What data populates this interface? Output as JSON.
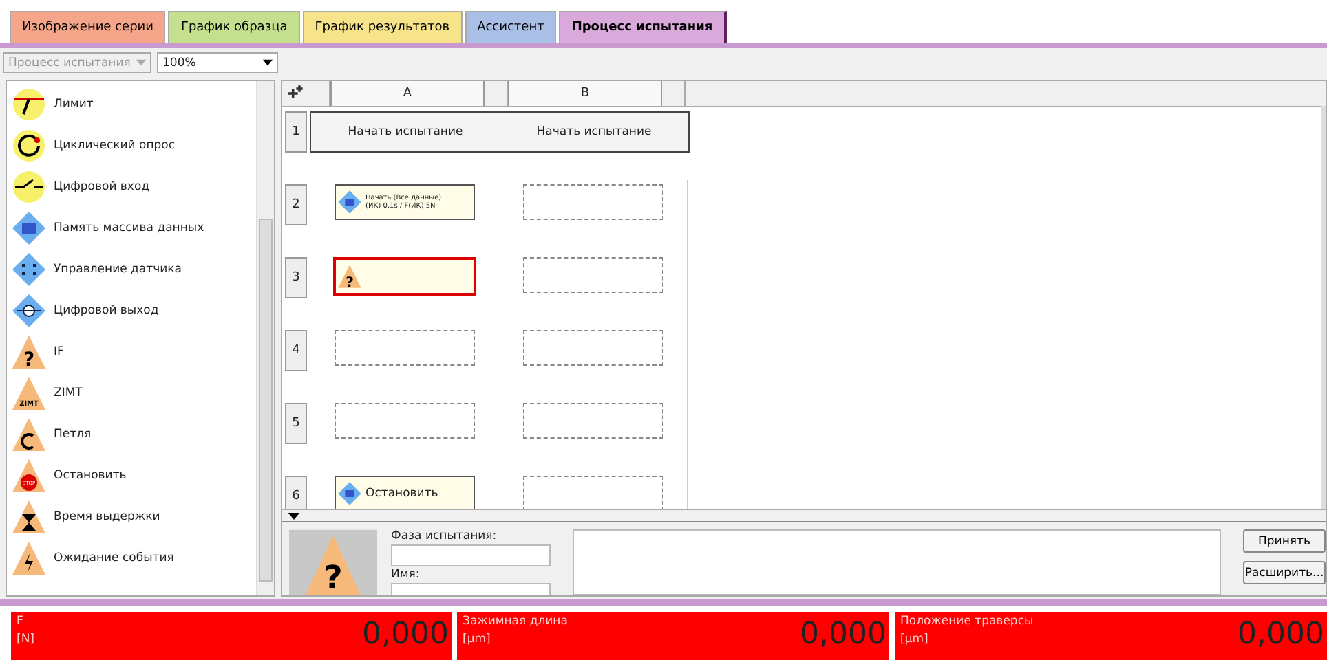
{
  "tabs": [
    {
      "label": "Изображение серии",
      "color": "#f4a58a",
      "selected": false
    },
    {
      "label": "График образца",
      "color": "#c4e08f",
      "selected": false
    },
    {
      "label": "График результатов",
      "color": "#f7e48a",
      "selected": false
    },
    {
      "label": "Ассистент",
      "color": "#a9bfe6",
      "selected": false
    },
    {
      "label": "Процесс испытания",
      "color": "#d9a9dc",
      "selected": true
    }
  ],
  "toolbar": {
    "process_select": {
      "value": "Процесс испытания",
      "disabled": true
    },
    "zoom_select": {
      "value": "100%",
      "disabled": false
    }
  },
  "palette": [
    {
      "label": "Лимит",
      "kind": "limit"
    },
    {
      "label": "Циклический опрос",
      "kind": "cycle"
    },
    {
      "label": "Цифровой вход",
      "kind": "digital_in"
    },
    {
      "label": "Память массива данных",
      "kind": "memory"
    },
    {
      "label": "Управление датчика",
      "kind": "sensor"
    },
    {
      "label": "Цифровой выход",
      "kind": "digital_out"
    },
    {
      "label": "IF",
      "kind": "if",
      "icon_text": "?"
    },
    {
      "label": "ZIMT",
      "kind": "zimt",
      "icon_text": "ZIMT"
    },
    {
      "label": "Петля",
      "kind": "loop"
    },
    {
      "label": "Остановить",
      "kind": "stop",
      "icon_text": "STOP"
    },
    {
      "label": "Время выдержки",
      "kind": "hold"
    },
    {
      "label": "Ожидание события",
      "kind": "wait"
    }
  ],
  "grid": {
    "columns": [
      "A",
      "B"
    ],
    "rows": [
      {
        "number": "1",
        "cells": [
          {
            "kind": "start",
            "label": "Начать испытание"
          },
          {
            "kind": "start",
            "label": "Начать испытание"
          }
        ]
      },
      {
        "number": "2",
        "cells": [
          {
            "kind": "memory",
            "lines": [
              "Начать (Все данные)",
              "(ИК) 0.1s / F(ИК) 5N"
            ],
            "selected": false
          },
          {
            "kind": "empty"
          }
        ]
      },
      {
        "number": "3",
        "cells": [
          {
            "kind": "if",
            "icon_text": "?",
            "selected": true
          },
          {
            "kind": "empty"
          }
        ]
      },
      {
        "number": "4",
        "cells": [
          {
            "kind": "empty"
          },
          {
            "kind": "empty"
          }
        ]
      },
      {
        "number": "5",
        "cells": [
          {
            "kind": "empty"
          },
          {
            "kind": "empty"
          }
        ]
      },
      {
        "number": "6",
        "cells": [
          {
            "kind": "memory",
            "lines": [
              "Остановить"
            ],
            "selected": false
          },
          {
            "kind": "empty"
          }
        ]
      }
    ]
  },
  "details": {
    "icon_text": "?",
    "phase_label": "Фаза испытания:",
    "name_label": "Имя:",
    "buttons": [
      "Принять",
      "Расширить..."
    ]
  },
  "status": [
    {
      "name": "F",
      "unit": "[N]",
      "value": "0,000"
    },
    {
      "name": "Зажимная длина",
      "unit": "[μm]",
      "value": "0,000"
    },
    {
      "name": "Положение траверсы",
      "unit": "[μm]",
      "value": "0,000"
    }
  ]
}
